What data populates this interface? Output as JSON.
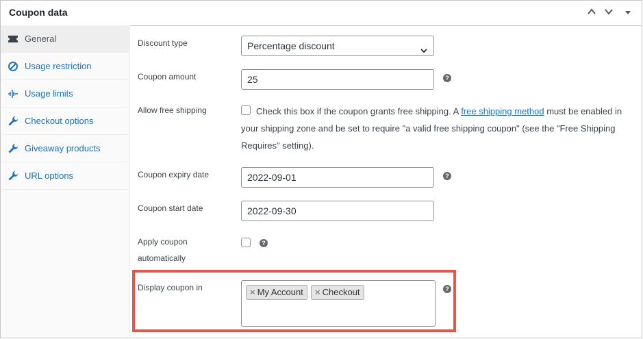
{
  "panel": {
    "title": "Coupon data"
  },
  "header_controls": [
    {
      "name": "move-up-button",
      "glyph": "chevron-up-icon"
    },
    {
      "name": "move-down-button",
      "glyph": "chevron-down-icon"
    },
    {
      "name": "toggle-panel-button",
      "glyph": "caret-down-icon"
    }
  ],
  "sidebar": {
    "items": [
      {
        "label": "General",
        "icon": "ticket-icon",
        "active": true
      },
      {
        "label": "Usage restriction",
        "icon": "no-entry-icon",
        "active": false
      },
      {
        "label": "Usage limits",
        "icon": "waveform-icon",
        "active": false
      },
      {
        "label": "Checkout options",
        "icon": "wrench-icon",
        "active": false
      },
      {
        "label": "Giveaway products",
        "icon": "wrench-icon",
        "active": false
      },
      {
        "label": "URL options",
        "icon": "wrench-icon",
        "active": false
      }
    ]
  },
  "form": {
    "discount_type": {
      "label": "Discount type",
      "value": "Percentage discount"
    },
    "coupon_amount": {
      "label": "Coupon amount",
      "value": "25"
    },
    "free_shipping": {
      "label": "Allow free shipping",
      "checked": false,
      "text_before": "Check this box if the coupon grants free shipping. A ",
      "link_text": "free shipping method",
      "text_after": " must be enabled in your shipping zone and be set to require \"a valid free shipping coupon\" (see the \"Free Shipping Requires\" setting)."
    },
    "expiry_date": {
      "label": "Coupon expiry date",
      "value": "2022-09-01"
    },
    "start_date": {
      "label": "Coupon start date",
      "value": "2022-09-30"
    },
    "apply_auto": {
      "label_line1": "Apply coupon",
      "label_line2": "automatically",
      "checked": false
    },
    "display_in": {
      "label": "Display coupon in",
      "chips": [
        {
          "label": "My Account",
          "remove": "×"
        },
        {
          "label": "Checkout",
          "remove": "×"
        }
      ]
    },
    "help_glyph": "?"
  },
  "colors": {
    "accent": "#2271b1",
    "highlight_border": "#e4574a",
    "active_tab_bg": "#eeeeee"
  }
}
